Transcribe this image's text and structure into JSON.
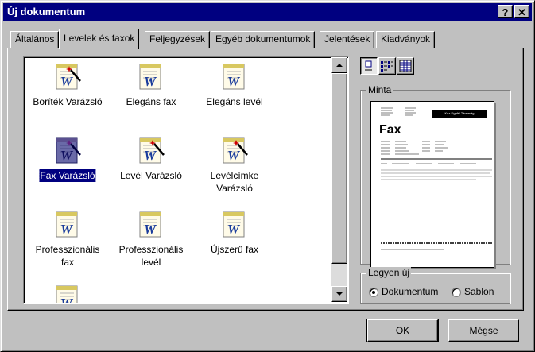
{
  "window": {
    "title": "Új dokumentum",
    "help_label": "?",
    "close_label": "✕"
  },
  "tabs": [
    "Általános",
    "Levelek és faxok",
    "Feljegyzések",
    "Egyéb dokumentumok",
    "Jelentések",
    "Kiadványok"
  ],
  "active_tab": "Levelek és faxok",
  "items": [
    {
      "label": "Boríték Varázsló",
      "icon": "wizard-document-icon",
      "selected": false
    },
    {
      "label": "Elegáns fax",
      "icon": "word-template-icon",
      "selected": false
    },
    {
      "label": "Elegáns levél",
      "icon": "word-template-icon",
      "selected": false
    },
    {
      "label": "Fax Varázsló",
      "icon": "wizard-document-icon",
      "selected": true
    },
    {
      "label": "Levél Varázsló",
      "icon": "wizard-document-icon",
      "selected": false
    },
    {
      "label": "Levélcímke Varázsló",
      "icon": "wizard-document-icon",
      "selected": false
    },
    {
      "label": "Professzionális fax",
      "icon": "word-template-icon",
      "selected": false
    },
    {
      "label": "Professzionális levél",
      "icon": "word-template-icon",
      "selected": false
    },
    {
      "label": "Újszerű fax",
      "icon": "word-template-icon",
      "selected": false
    },
    {
      "label": "",
      "icon": "word-template-icon",
      "selected": false
    }
  ],
  "preview": {
    "group_label": "Minta",
    "doc_heading": "Fax",
    "doc_banner": "Kéz Ügyfél Társaság"
  },
  "create_new": {
    "group_label": "Legyen új",
    "options": [
      "Dokumentum",
      "Sablon"
    ],
    "selected": "Dokumentum"
  },
  "buttons": {
    "ok": "OK",
    "cancel": "Mégse"
  },
  "view_modes": [
    "large-icons-view",
    "list-view",
    "details-view"
  ],
  "colors": {
    "titlebar": "#000080",
    "face": "#c0c0c0",
    "selection": "#000080"
  }
}
